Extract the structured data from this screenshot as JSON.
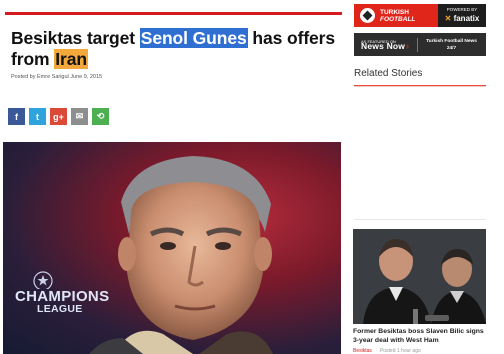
{
  "article": {
    "title_part1": "Besiktas target ",
    "title_highlight1": "Senol Gunes",
    "title_part2": " has offers from ",
    "title_highlight2": "Iran",
    "byline": "Posted by Emre Sarigul June 9, 2015"
  },
  "share": {
    "facebook": "f",
    "twitter": "t",
    "google": "g+",
    "email": "✉",
    "sharethis": "⟲"
  },
  "hero": {
    "league_text_1": "CHAMPIONS",
    "league_text_2": "LEAGUE"
  },
  "sidebar": {
    "banner_turkish_football": {
      "title_1": "TURKISH",
      "title_2": "FOOTBALL",
      "powered": "POWERED BY",
      "partner": "fanatix"
    },
    "banner_newsnow": {
      "featured": "AS FEATURED ON",
      "brand": "News Now",
      "arrow": "›",
      "right_1": "Turkish Football News",
      "right_2": "24/7"
    },
    "related_title": "Related Stories",
    "story": {
      "title": "Former Besiktas boss Slaven Bilic signs 3-year deal with West Ham",
      "tag": "Besiktas",
      "time": "Posted 1 hour ago"
    }
  },
  "colors": {
    "accent_red": "#d71a1f",
    "highlight_blue": "#2f6fd1",
    "highlight_orange": "#f3a83b"
  },
  "icons": [
    "facebook-icon",
    "twitter-icon",
    "google-plus-icon",
    "email-icon",
    "sharethis-icon",
    "football-icon"
  ]
}
